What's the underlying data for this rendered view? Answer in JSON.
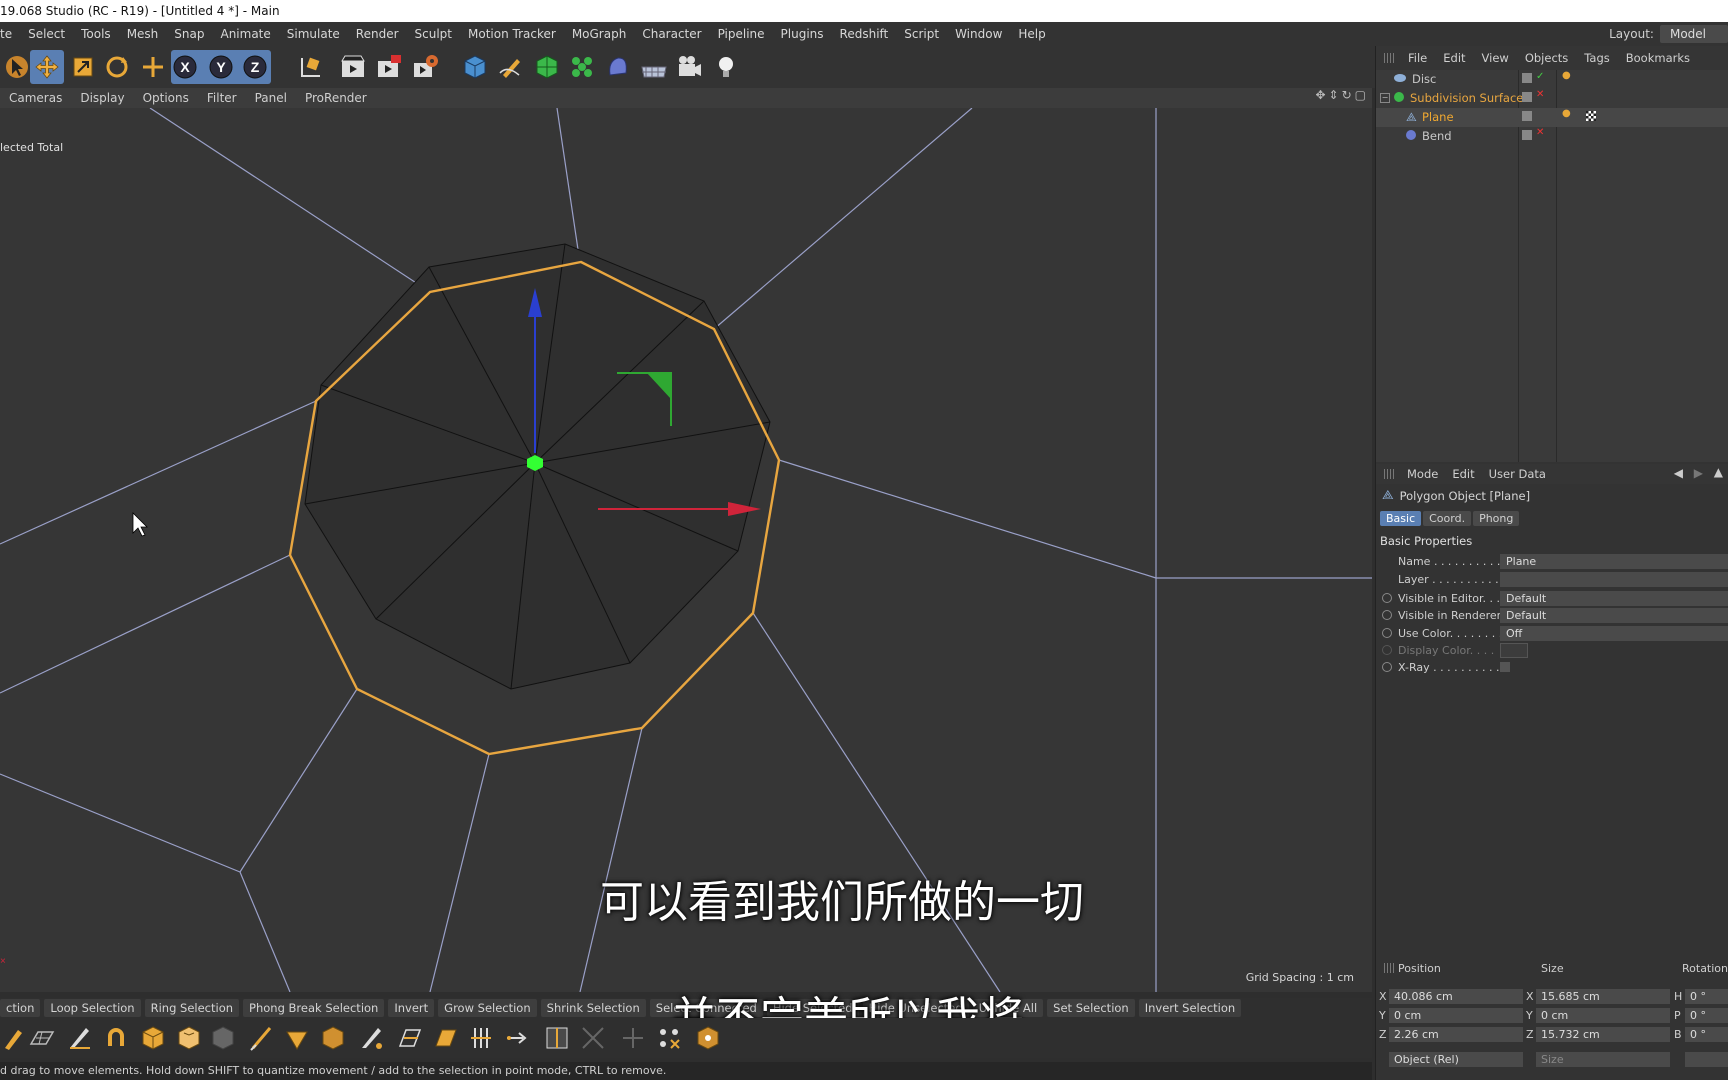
{
  "window": {
    "title": "19.068 Studio (RC - R19) - [Untitled 4 *] - Main"
  },
  "menubar": [
    "te",
    "Select",
    "Tools",
    "Mesh",
    "Snap",
    "Animate",
    "Simulate",
    "Render",
    "Sculpt",
    "Motion Tracker",
    "MoGraph",
    "Character",
    "Pipeline",
    "Plugins",
    "Redshift",
    "Script",
    "Window",
    "Help"
  ],
  "layout": {
    "label": "Layout:",
    "value": "Model"
  },
  "toolbar": {
    "icons": [
      "select-arrow-icon",
      "move-icon",
      "scale-icon",
      "rotate-icon",
      "add-move-icon",
      "x-axis-icon",
      "y-axis-icon",
      "z-axis-icon",
      "coordinate-system-icon",
      "render-view-icon",
      "render-picture-viewer-icon",
      "render-settings-icon",
      "cube-icon",
      "pen-icon",
      "subdivision-icon",
      "cloner-icon",
      "deformer-icon",
      "floor-icon",
      "camera-icon",
      "light-icon"
    ],
    "axis_labels": [
      "X",
      "Y",
      "Z"
    ]
  },
  "viewport": {
    "menu": [
      "Cameras",
      "Display",
      "Options",
      "Filter",
      "Panel",
      "ProRender"
    ],
    "selection_info": "lected Total",
    "grid_spacing": "Grid Spacing : 1 cm"
  },
  "subtitles": {
    "line1": "可以看到我们所做的一切",
    "line2": "并不完美所以我将"
  },
  "commands": [
    "ction",
    "Loop Selection",
    "Ring Selection",
    "Phong Break Selection",
    "Invert",
    "Grow Selection",
    "Shrink Selection",
    "Select Connected",
    "Hide Selected",
    "Hide Unselected",
    "Unhide All",
    "Set Selection",
    "Invert Selection"
  ],
  "status": "d drag to move elements. Hold down SHIFT to quantize movement / add to the selection in point mode, CTRL to remove.",
  "object_manager": {
    "menu": [
      "File",
      "Edit",
      "View",
      "Objects",
      "Tags",
      "Bookmarks"
    ],
    "objects": [
      {
        "name": "Disc",
        "color": "#c8c8c8"
      },
      {
        "name": "Subdivision Surface",
        "color": "#e8a640"
      },
      {
        "name": "Plane",
        "color": "#f0a830"
      },
      {
        "name": "Bend",
        "color": "#c8c8c8"
      }
    ]
  },
  "attributes": {
    "menu": [
      "Mode",
      "Edit",
      "User Data"
    ],
    "object_title": "Polygon Object [Plane]",
    "tabs": [
      "Basic",
      "Coord.",
      "Phong"
    ],
    "section": "Basic Properties",
    "props": [
      {
        "label": "Name . . . . . . . . . . . .",
        "value": "Plane"
      },
      {
        "label": "Layer . . . . . . . . . . . .",
        "value": ""
      },
      {
        "label": "Visible in Editor. . .",
        "value": "Default"
      },
      {
        "label": "Visible in Renderer",
        "value": "Default"
      },
      {
        "label": "Use Color. . . . . . . .",
        "value": "Off"
      },
      {
        "label": "Display Color. . . .",
        "value": ""
      },
      {
        "label": "X-Ray . . . . . . . . . . .",
        "value": ""
      }
    ]
  },
  "coordinates": {
    "headers": [
      "Position",
      "Size",
      "Rotation"
    ],
    "rows": [
      {
        "axis": "X",
        "pos": "40.086 cm",
        "size_axis": "X",
        "size": "15.685 cm",
        "rot_axis": "H",
        "rot": "0 °"
      },
      {
        "axis": "Y",
        "pos": "0 cm",
        "size_axis": "Y",
        "size": "0 cm",
        "rot_axis": "P",
        "rot": "0 °"
      },
      {
        "axis": "Z",
        "pos": "2.26 cm",
        "size_axis": "Z",
        "size": "15.732 cm",
        "rot_axis": "B",
        "rot": "0 °"
      }
    ],
    "mode": "Object (Rel)",
    "size_mode": "Size"
  },
  "colors": {
    "accent": "#5a7fb3",
    "selection_edge": "#e8a640",
    "axis_x": "#d0243a",
    "axis_y": "#2fa832",
    "axis_z": "#2a3fd0"
  }
}
